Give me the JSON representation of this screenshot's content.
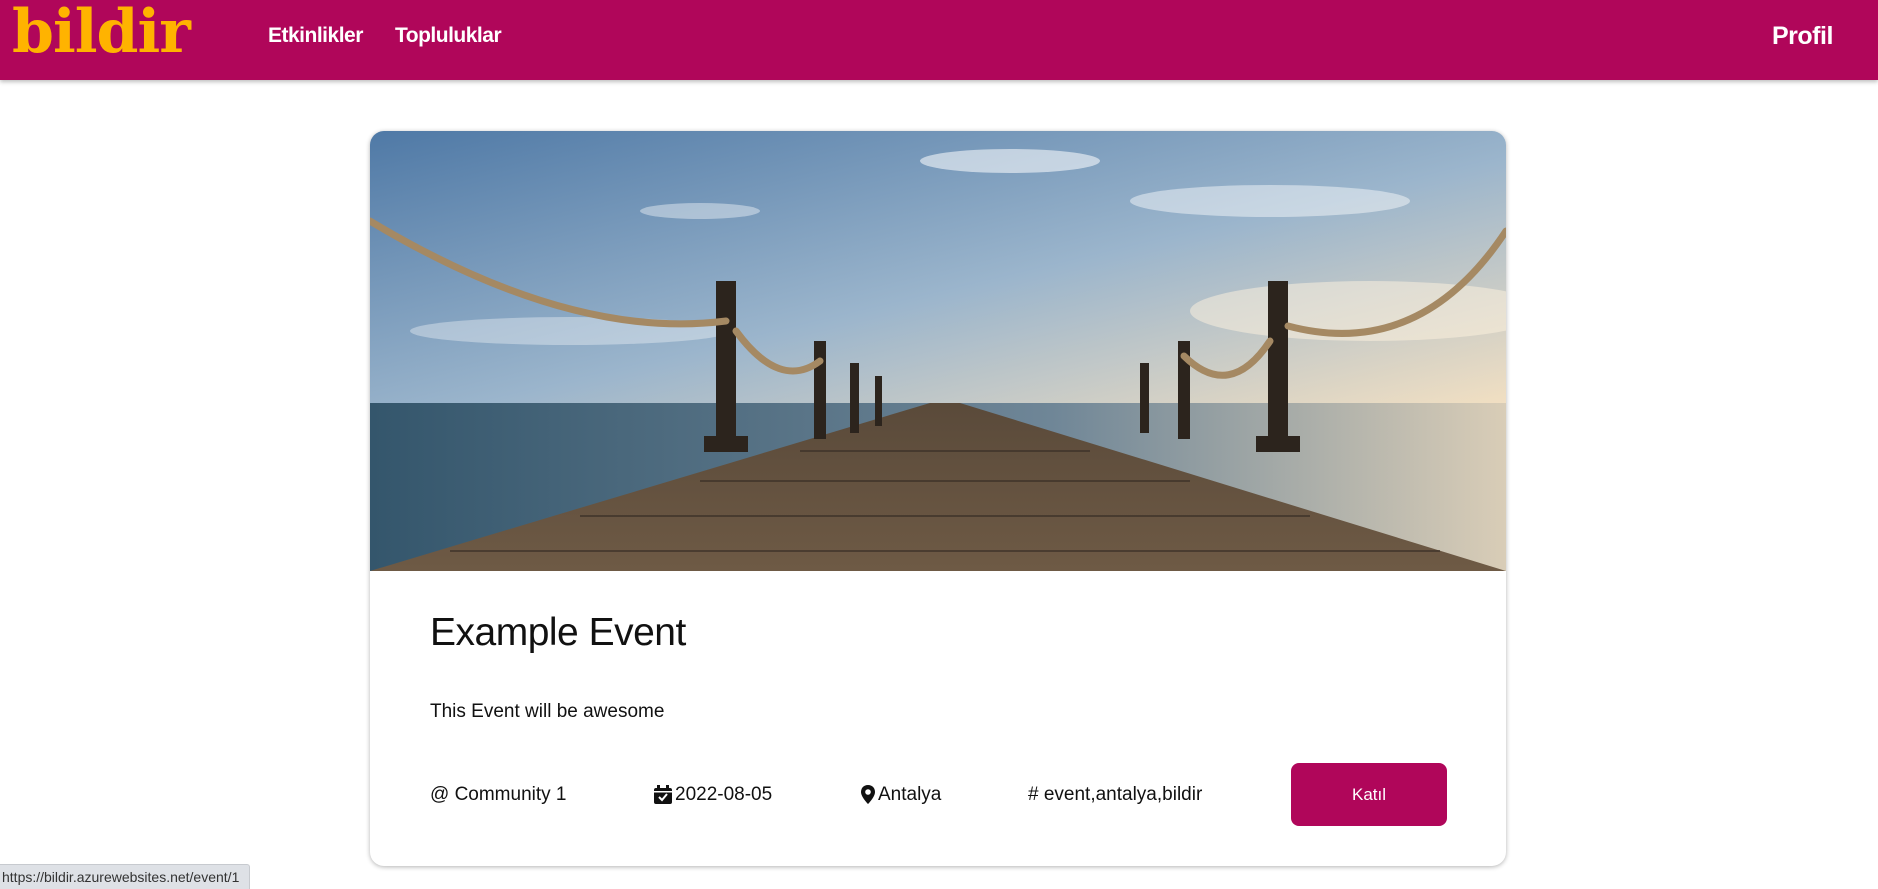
{
  "navbar": {
    "logo": "bildir",
    "links": [
      {
        "label": "Etkinlikler"
      },
      {
        "label": "Topluluklar"
      }
    ],
    "profile_label": "Profil"
  },
  "event": {
    "title": "Example Event",
    "description": "This Event will be awesome",
    "community": "@ Community 1",
    "date": "2022-08-05",
    "location": "Antalya",
    "tags": "# event,antalya,bildir",
    "join_label": "Katıl"
  },
  "status_bar": {
    "url": "https://bildir.azurewebsites.net/event/1"
  },
  "colors": {
    "brand": "#b0065a",
    "logo": "#ffb300"
  },
  "icons": {
    "date": "calendar-check-icon",
    "location": "map-pin-icon"
  }
}
